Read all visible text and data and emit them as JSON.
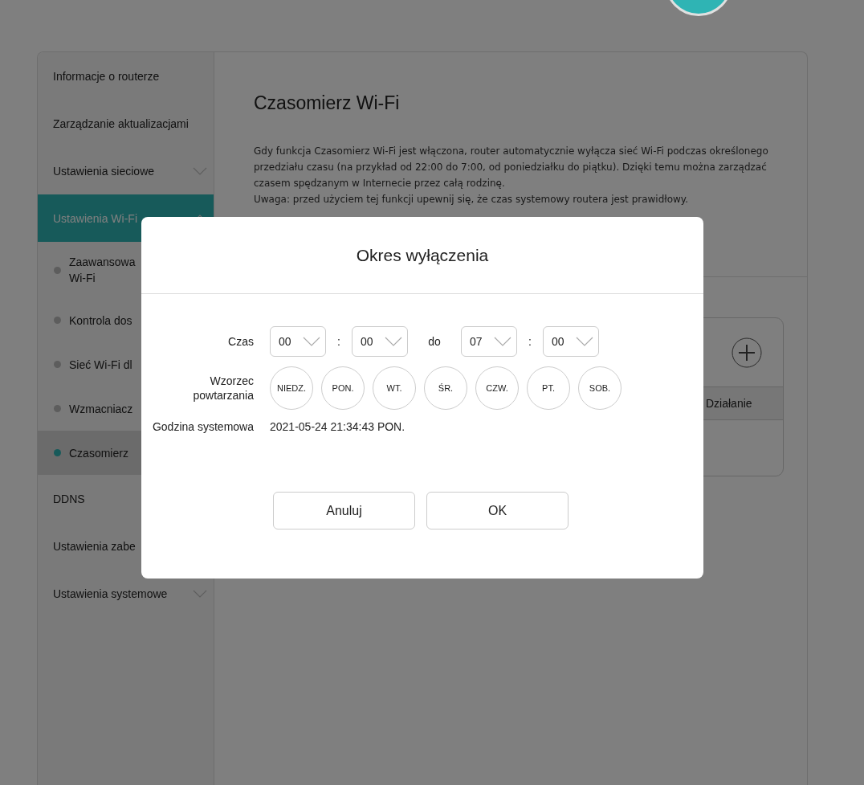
{
  "sidebar": {
    "items": [
      {
        "label": "Informacje o routerze",
        "kind": "item",
        "selected": false
      },
      {
        "label": "Zarządzanie aktualizacjami",
        "kind": "item",
        "selected": false
      },
      {
        "label": "Ustawienia sieciowe",
        "kind": "group",
        "selected": false,
        "expanded": false
      },
      {
        "label": "Ustawienia Wi-Fi",
        "kind": "group",
        "selected": true,
        "expanded": true,
        "children": [
          {
            "label": "Zaawansowa",
            "label_2": "Wi-Fi",
            "selected": false
          },
          {
            "label": "Kontrola dos",
            "selected": false
          },
          {
            "label": "Sieć Wi-Fi dl",
            "selected": false
          },
          {
            "label": "Wzmacniacz",
            "selected": false
          },
          {
            "label": "Czasomierz",
            "selected": true
          }
        ]
      },
      {
        "label": "DDNS",
        "kind": "item",
        "selected": false
      },
      {
        "label": "Ustawienia zabe",
        "kind": "item",
        "selected": false
      },
      {
        "label": "Ustawienia systemowe",
        "kind": "group",
        "selected": false,
        "expanded": false
      }
    ]
  },
  "content": {
    "title": "Czasomierz Wi-Fi",
    "description": [
      "Gdy funkcja Czasomierz Wi-Fi jest włączona, router automatycznie wyłącza sieć Wi-Fi podczas określonego przedziału czasu (na przykład od 22:00 do 7:00, od poniedziałku do piątku). Dzięki temu można zarządzać czasem spędzanym w Internecie przez całą rodzinę.",
      "Uwaga: przed użyciem tej funkcji upewnij się, że czas systemowy routera jest prawidłowy."
    ],
    "table": {
      "column_header": "Działanie"
    }
  },
  "dialog": {
    "title": "Okres wyłączenia",
    "time_label": "Czas",
    "start_hour": "00",
    "separator_1": ":",
    "start_minute": "00",
    "to_label": "do",
    "end_hour": "07",
    "separator_2": ":",
    "end_minute": "00",
    "repeat_label": "Wzorzec powtarzania",
    "days": [
      {
        "label": "NIEDZ.",
        "selected": false
      },
      {
        "label": "PON.",
        "selected": false
      },
      {
        "label": "WT.",
        "selected": false
      },
      {
        "label": "ŚR.",
        "selected": false
      },
      {
        "label": "CZW.",
        "selected": false
      },
      {
        "label": "PT.",
        "selected": false
      },
      {
        "label": "SOB.",
        "selected": false
      }
    ],
    "system_time_label": "Godzina systemowa",
    "system_time": "2021-05-24 21:34:43 PON.",
    "buttons": [
      "Anuluj",
      "OK"
    ]
  }
}
